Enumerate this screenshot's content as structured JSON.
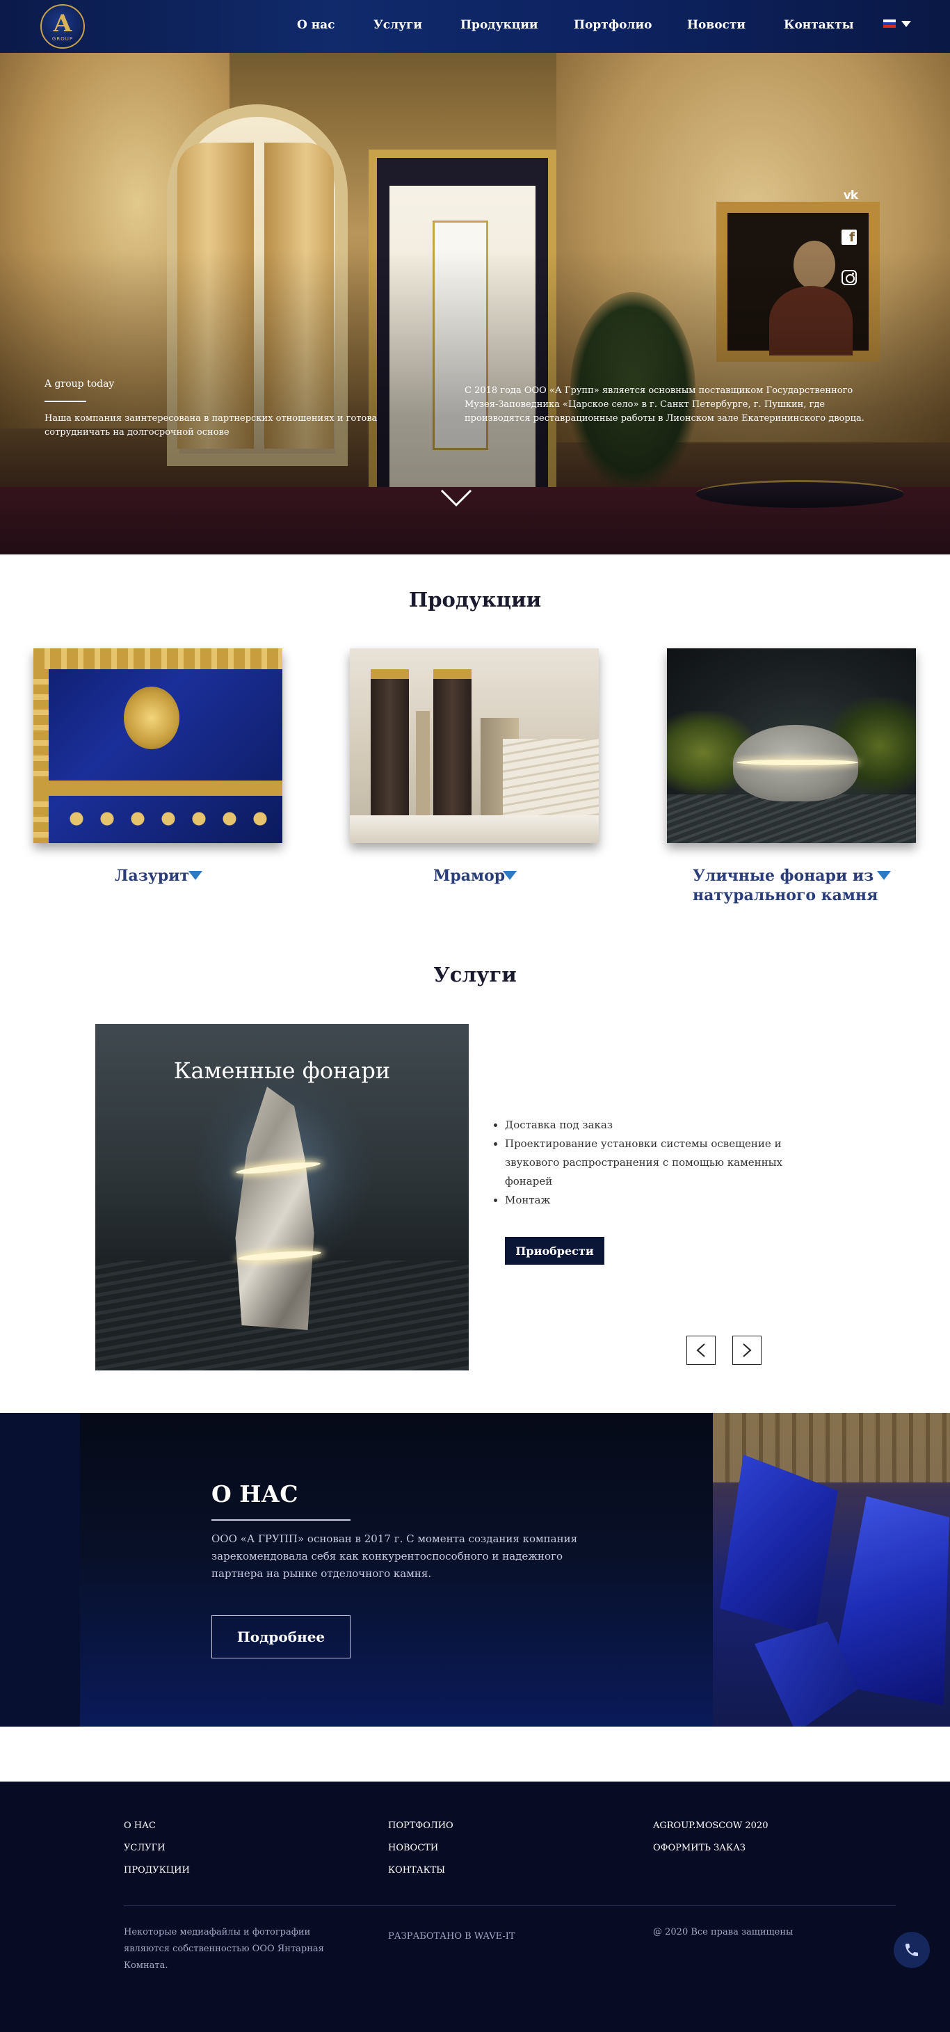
{
  "header": {
    "logo_letter": "A",
    "logo_sub": "GROUP",
    "nav": [
      "О нас",
      "Услуги",
      "Продукции",
      "Портфолио",
      "Новости",
      "Контакты"
    ],
    "language_icon": "russian-flag-icon"
  },
  "hero": {
    "kicker": "A group today",
    "left_text": "Наша компания заинтересована в партнерских отношениях и готова сотрудничать на долгосрочной основе",
    "right_text": "С 2018 года ООО «А Групп» является основным поставщиком Государственного Музея-Заповедника «Царское село» в г. Санкт Петербурге, г. Пушкин, где производятся реставрационные работы в Лионском зале Екатерининского дворца.",
    "social_icons": [
      "vk-icon",
      "facebook-icon",
      "instagram-icon"
    ],
    "vk_label": "vk",
    "fb_label": "f"
  },
  "products": {
    "title": "Продукции",
    "items": [
      {
        "label": "Лазурит"
      },
      {
        "label": "Мрамор"
      },
      {
        "label": "Уличные фонари из натурального камня"
      }
    ]
  },
  "services": {
    "title": "Услуги",
    "slide_title": "Каменные фонари",
    "bullets": [
      "Доставка под заказ",
      "Проектирование установки системы освещение и звукового распространения с помощью каменных фонарей",
      "Монтаж"
    ],
    "buy_label": "Приобрести"
  },
  "about": {
    "title": "О НАС",
    "text": "ООО «А ГРУПП» основан в 2017 г. С момента создания компания зарекомендовала себя как конкурентоспособного и надежного партнера на рынке отделочного камня.",
    "more_label": "Подробнее"
  },
  "footer": {
    "col1": [
      "О НАС",
      "УСЛУГИ",
      "ПРОДУКЦИИ"
    ],
    "col2": [
      "ПОРТФОЛИО",
      "НОВОСТИ",
      "КОНТАКТЫ"
    ],
    "col3": [
      "AGROUP.MOSCOW 2020",
      "ОФОРМИТЬ ЗАКАЗ"
    ],
    "note_left": "Некоторые медиафайлы и фотографии являются собственностью ООО Янтарная Комната.",
    "note_mid": "РАЗРАБОТАНО В WAVE-IT",
    "note_right": "@ 2020 Все права защищены"
  },
  "colors": {
    "nav_bg": "#0d2260",
    "accent_blue": "#2b3d78",
    "triangle": "#2d79c4",
    "footer_bg": "#070b24",
    "button_dark": "#0b1535"
  }
}
